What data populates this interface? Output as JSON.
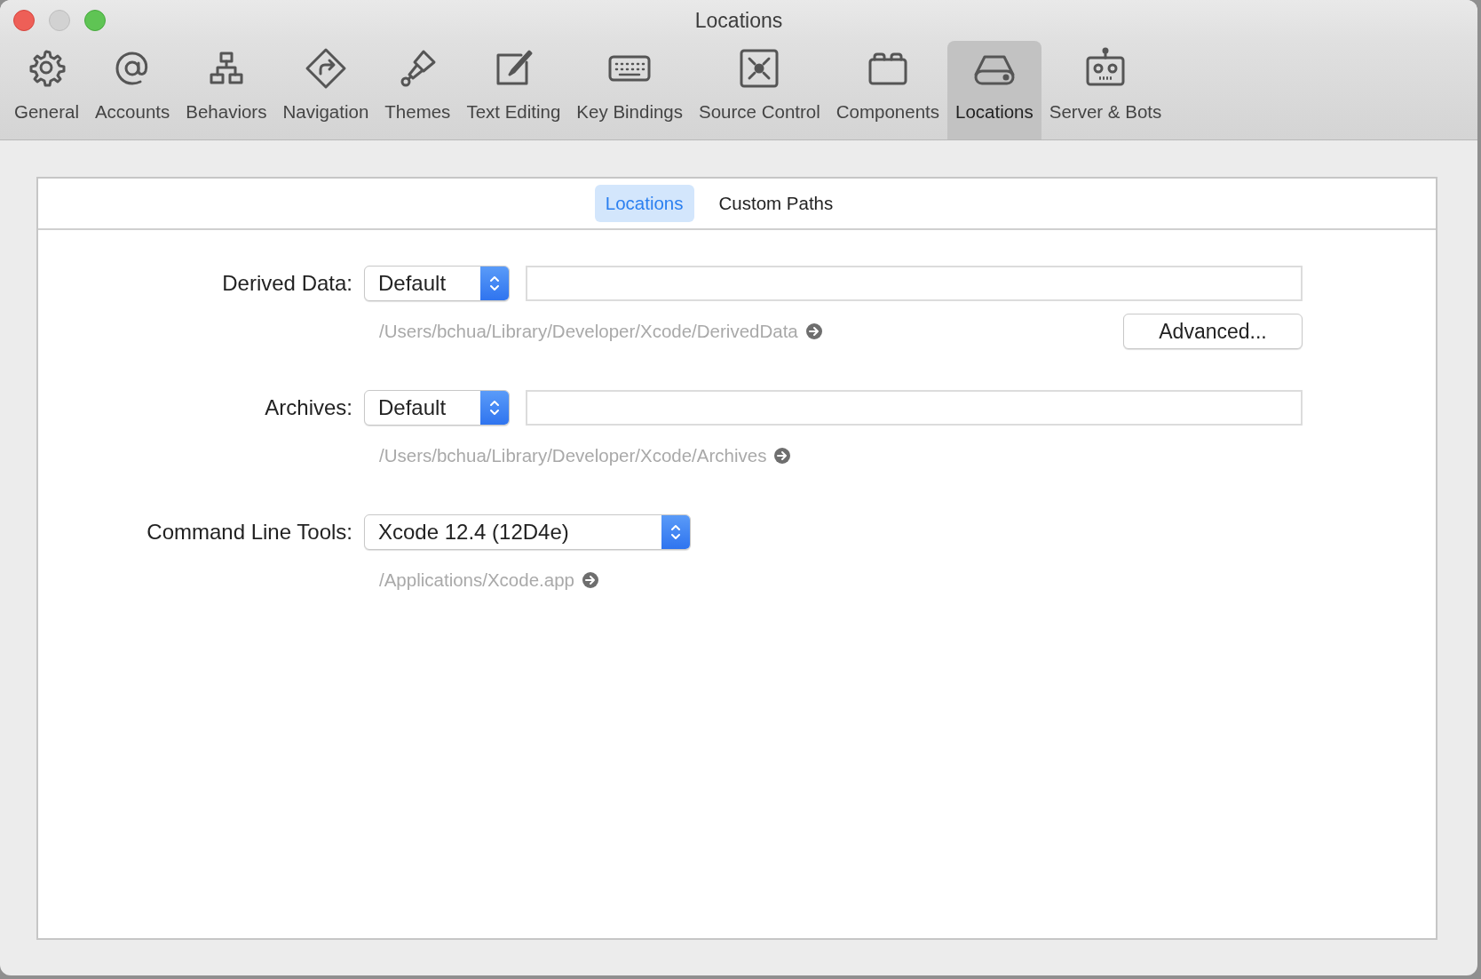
{
  "window": {
    "title": "Locations"
  },
  "toolbar": [
    {
      "label": "General",
      "selected": false
    },
    {
      "label": "Accounts",
      "selected": false
    },
    {
      "label": "Behaviors",
      "selected": false
    },
    {
      "label": "Navigation",
      "selected": false
    },
    {
      "label": "Themes",
      "selected": false
    },
    {
      "label": "Text Editing",
      "selected": false
    },
    {
      "label": "Key Bindings",
      "selected": false
    },
    {
      "label": "Source Control",
      "selected": false
    },
    {
      "label": "Components",
      "selected": false
    },
    {
      "label": "Locations",
      "selected": true
    },
    {
      "label": "Server & Bots",
      "selected": false
    }
  ],
  "tabs": [
    {
      "label": "Locations",
      "selected": true
    },
    {
      "label": "Custom Paths",
      "selected": false
    }
  ],
  "rows": [
    {
      "kind": "location",
      "label": "Derived Data:",
      "value": "Default",
      "path": "/Users/bchua/Library/Developer/Xcode/DerivedData",
      "button": "Advanced..."
    },
    {
      "kind": "location",
      "label": "Archives:",
      "value": "Default",
      "path": "/Users/bchua/Library/Developer/Xcode/Archives"
    },
    {
      "kind": "select",
      "label": "Command Line Tools:",
      "value": "Xcode 12.4 (12D4e)",
      "path": "/Applications/Xcode.app"
    }
  ]
}
